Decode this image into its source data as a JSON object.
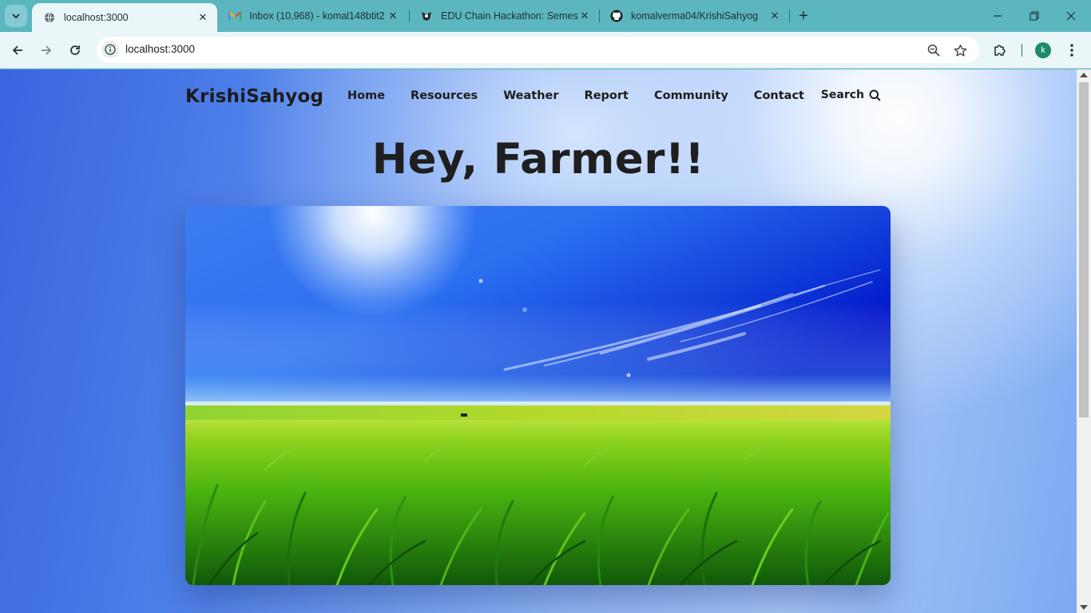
{
  "browser": {
    "tabs": [
      {
        "title": "localhost:3000",
        "active": true,
        "favicon": "globe-icon"
      },
      {
        "title": "Inbox (10,968) - komal148btit2",
        "active": false,
        "favicon": "gmail-icon"
      },
      {
        "title": "EDU Chain Hackathon: Semeste",
        "active": false,
        "favicon": "hackathon-icon"
      },
      {
        "title": "komalverma04/KrishiSahyog",
        "active": false,
        "favicon": "github-icon"
      }
    ],
    "address": "localhost:3000",
    "profile_initial": "k"
  },
  "site": {
    "brand": "KrishiSahyog",
    "menu": [
      "Home",
      "Resources",
      "Weather",
      "Report",
      "Community",
      "Contact"
    ],
    "search_label": "Search",
    "hero_title": "Hey, Farmer!!"
  },
  "colors": {
    "tab_strip": "#5bb6c0",
    "toolbar": "#eaf6f7",
    "text_dark": "#1c1c1c",
    "page_blue": "#4d7fe8"
  }
}
